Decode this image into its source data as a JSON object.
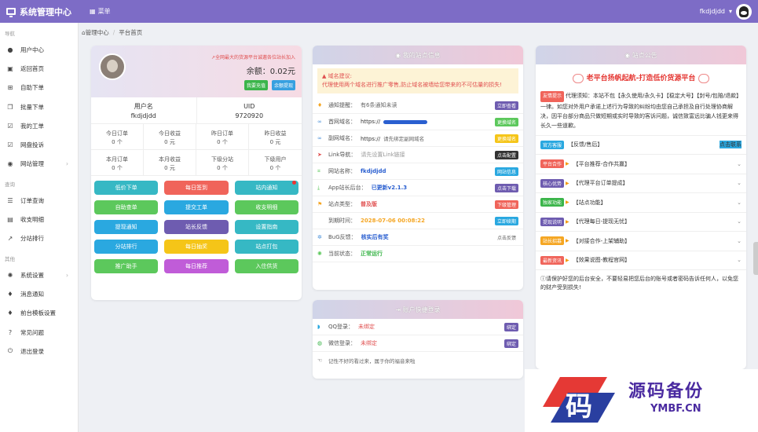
{
  "header": {
    "title": "系统管理中心",
    "menu": "菜单",
    "user": "fkdjdjdd"
  },
  "sidebar": {
    "sections": [
      {
        "label": "导航",
        "items": [
          {
            "label": "用户中心",
            "icon": "person-icon"
          },
          {
            "label": "返回首页",
            "icon": "box-icon"
          },
          {
            "label": "自助下单",
            "icon": "cart-icon"
          },
          {
            "label": "批量下单",
            "icon": "copy-icon"
          },
          {
            "label": "我的工单",
            "icon": "check-icon"
          },
          {
            "label": "网盘投诉",
            "icon": "check-icon"
          },
          {
            "label": "网站管理",
            "icon": "globe-icon",
            "arrow": true
          }
        ]
      },
      {
        "label": "查询",
        "items": [
          {
            "label": "订单查询",
            "icon": "list-icon"
          },
          {
            "label": "收支明细",
            "icon": "wallet-icon"
          },
          {
            "label": "分站排行",
            "icon": "chart-icon"
          }
        ]
      },
      {
        "label": "其他",
        "items": [
          {
            "label": "系统设置",
            "icon": "gear-icon",
            "arrow": true
          },
          {
            "label": "消息通知",
            "icon": "bell-icon"
          },
          {
            "label": "前台模板设置",
            "icon": "bell-icon"
          },
          {
            "label": "常见问题",
            "icon": "question-icon"
          },
          {
            "label": "退出登录",
            "icon": "power-icon"
          }
        ]
      }
    ]
  },
  "breadcrumb": {
    "home": "管理中心",
    "current": "平台首页"
  },
  "usercard": {
    "tip": "全网最大的货源平台诚邀各位站长加入",
    "balance_label": "余额：",
    "balance": "0.02元",
    "btn_recharge": "我要充值",
    "btn_withdraw": "余额提现",
    "username_label": "用户名",
    "username": "fkdjdjdd",
    "uid_label": "UID",
    "uid": "9720920",
    "stats": [
      {
        "label": "今日订单",
        "value": "0 个"
      },
      {
        "label": "今日收益",
        "value": "0 元"
      },
      {
        "label": "昨日订单",
        "value": "0 个"
      },
      {
        "label": "昨日收益",
        "value": "0 元"
      },
      {
        "label": "本月订单",
        "value": "0 个"
      },
      {
        "label": "本月收益",
        "value": "0 元"
      },
      {
        "label": "下级分站",
        "value": "0 个"
      },
      {
        "label": "下级用户",
        "value": "0 个"
      }
    ],
    "buttons": [
      {
        "label": "低价下单",
        "color": "#36b8c4"
      },
      {
        "label": "每日签到",
        "color": "#f0645a"
      },
      {
        "label": "站内通知",
        "color": "#36b8c4",
        "dot": true
      },
      {
        "label": "自助查单",
        "color": "#5cc85c"
      },
      {
        "label": "提交工单",
        "color": "#2aa8e0"
      },
      {
        "label": "收支明细",
        "color": "#5cc85c"
      },
      {
        "label": "提现通知",
        "color": "#2aa8e0"
      },
      {
        "label": "站长反馈",
        "color": "#6e5cb0"
      },
      {
        "label": "设置指南",
        "color": "#36b8c4"
      },
      {
        "label": "分站排行",
        "color": "#2aa8e0"
      },
      {
        "label": "每日抽奖",
        "color": "#f5c518"
      },
      {
        "label": "站点打包",
        "color": "#36b8c4"
      },
      {
        "label": "推广助手",
        "color": "#5cc85c"
      },
      {
        "label": "每日推荐",
        "color": "#c05cd8"
      },
      {
        "label": "入住供货",
        "color": "#5cc85c"
      }
    ]
  },
  "siteinfo": {
    "title": "我的站点信息",
    "warn_title": "域名建议:",
    "warn_text": "代理使用两个域名进行推广零售,防止域名被墙给您带来的不可估量的损失!",
    "rows": [
      {
        "label": "通知提醒：",
        "value": "有6条通知未读",
        "badge": "立即查看",
        "badge_color": "#6e5cb0",
        "icon": "bell-icon",
        "icolor": "#f5a623",
        "vcolor": "#666"
      },
      {
        "label": "首网域名：",
        "value": "https://",
        "badge": "更换域名",
        "badge_color": "#5cc85c",
        "icon": "link-icon",
        "icolor": "#4a90d9",
        "vcolor": "#333",
        "masked": true
      },
      {
        "label": "副网域名：",
        "value": "https://",
        "hint": "请先绑定副网域名",
        "badge": "更换域名",
        "badge_color": "#f5c518",
        "icon": "link-icon",
        "icolor": "#4a90d9",
        "vcolor": "#333"
      },
      {
        "label": "Link导航：",
        "value": "请先设置Link链接",
        "badge": "点击配置",
        "badge_color": "#333",
        "icon": "send-icon",
        "icolor": "#e05050",
        "vcolor": "#999"
      },
      {
        "label": "网站名称：",
        "value": "fkdjdjdd",
        "badge": "网站信息",
        "badge_color": "#2aa8e0",
        "icon": "tag-icon",
        "icolor": "#5cc85c",
        "vcolor": "#2a5fd0"
      },
      {
        "label": "App站长后台：",
        "value": "已更新v2.1.3",
        "badge": "点击下载",
        "badge_color": "#6e5cb0",
        "icon": "download-icon",
        "icolor": "#5cc85c",
        "vcolor": "#2a5fd0"
      },
      {
        "label": "站点类型：",
        "value": "普及版",
        "badge": "下级管理",
        "badge_color": "#f0645a",
        "icon": "flag-icon",
        "icolor": "#f5a623",
        "vcolor": "#e05050"
      },
      {
        "label": "到期时间：",
        "value": "2028-07-06 00:08:22",
        "badge": "立即续期",
        "badge_color": "#2aa8e0",
        "icon": "",
        "icolor": "#333",
        "vcolor": "#f5a623"
      },
      {
        "label": "BuG反馈：",
        "value": "核实后有奖",
        "badge": "点击反馈",
        "badge_color": "",
        "icon": "bug-icon",
        "icolor": "#4a90d9",
        "vcolor": "#2a5fd0"
      },
      {
        "label": "当前状态：",
        "value": "正常运行",
        "badge": "",
        "badge_color": "",
        "icon": "gear-icon",
        "icolor": "#5cc85c",
        "vcolor": "#3bb54a"
      }
    ]
  },
  "quicklogin": {
    "title": "账户快捷登录",
    "rows": [
      {
        "label": "QQ登录：",
        "value": "未绑定",
        "badge": "绑定",
        "icon": "qq-icon",
        "icolor": "#2aa8e0"
      },
      {
        "label": "微信登录：",
        "value": "未绑定",
        "badge": "绑定",
        "icon": "wechat-icon",
        "icolor": "#3bb54a"
      }
    ],
    "note": "记性不好的看过来，属于你的福音来啦"
  },
  "notice": {
    "title": "站点公告",
    "banner": "老平台扬帆起航-打造低价货源平台",
    "intro_tag": "友情提示",
    "intro": "代理须知：本站不包【永久使用/永久卡】【稳定大号】【封号/包赔/退款】一律。如您对外用户承诺上述行为导致的纠纷均由您自己承担及自行处理协商解决，因平台部分商品只做短期或实时导致的客诉问题，诚信致富远比骗人钱更来得长久一些道歉。",
    "rows": [
      {
        "tag": "官方客服",
        "tag_color": "#2aa8e0",
        "text": "【反馈/售后】",
        "btn": "点击联系",
        "hot": false
      },
      {
        "tag": "平台合作",
        "tag_color": "#f0645a",
        "text": "【平台推荐-合作共赢】",
        "hot": true
      },
      {
        "tag": "核心优势",
        "tag_color": "#6e5cb0",
        "text": "【代理平台订单提成】",
        "hot": true
      },
      {
        "tag": "独家功能",
        "tag_color": "#3bb54a",
        "text": "【站点功能】",
        "hot": true
      },
      {
        "tag": "提现说明",
        "tag_color": "#6e5cb0",
        "text": "【代理每日-提现无忧】",
        "hot": true
      },
      {
        "tag": "站长招募",
        "tag_color": "#f5a623",
        "text": "【对接合作-上架辅助】",
        "hot": true
      },
      {
        "tag": "最新资讯",
        "tag_color": "#f0645a",
        "text": "【效果说图-教程官网】",
        "hot": true
      }
    ],
    "foot": "请保护好您的后台安全，不要轻易把您后台的账号或者密码告诉任何人，以免您的财产受到损失!"
  },
  "watermark": {
    "char": "码",
    "name": "源码备份",
    "site": "YMBF.CN"
  },
  "colors": {
    "primary": "#7d6cc6"
  }
}
